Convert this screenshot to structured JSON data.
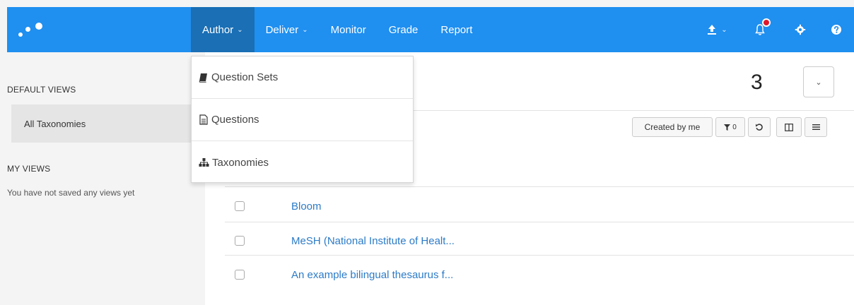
{
  "nav": {
    "items": [
      {
        "label": "Author",
        "has_caret": true,
        "active": true
      },
      {
        "label": "Deliver",
        "has_caret": true,
        "active": false
      },
      {
        "label": "Monitor",
        "has_caret": false,
        "active": false
      },
      {
        "label": "Grade",
        "has_caret": false,
        "active": false
      },
      {
        "label": "Report",
        "has_caret": false,
        "active": false
      }
    ],
    "right_icons": [
      "upload-icon",
      "bell-icon",
      "gear-icon",
      "help-icon"
    ],
    "caret": "⌄"
  },
  "author_menu": {
    "items": [
      {
        "label": "Question Sets",
        "icon": "book-icon"
      },
      {
        "label": "Questions",
        "icon": "document-icon"
      },
      {
        "label": "Taxonomies",
        "icon": "hierarchy-icon"
      }
    ]
  },
  "sidebar": {
    "default_views_heading": "DEFAULT VIEWS",
    "all_taxonomies": "All Taxonomies",
    "my_views_heading": "MY VIEWS",
    "empty_text": "You have not saved any views yet"
  },
  "main": {
    "count": "3",
    "created_by_me": "Created by me",
    "filter_count": "0",
    "rows": [
      {
        "name": "Bloom"
      },
      {
        "name": "MeSH (National Institute of Healt..."
      },
      {
        "name": "An example bilingual thesaurus f..."
      }
    ]
  },
  "colors": {
    "nav_bar": "#1f8ff0",
    "nav_active": "#1a6fb5",
    "link": "#2c7bc7",
    "notification_dot": "#e0182d"
  }
}
